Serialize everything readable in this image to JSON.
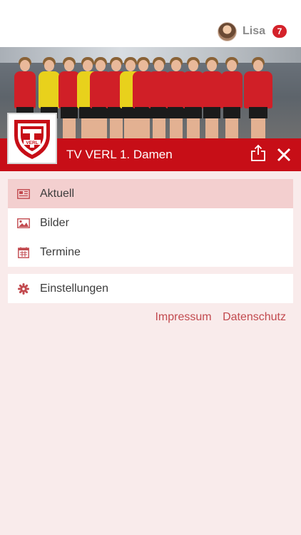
{
  "user": {
    "name": "Lisa",
    "notification_count": "7"
  },
  "team": {
    "title": "TV VERL 1. Damen",
    "logo_text": "VERL",
    "logo_year_left": "19",
    "logo_year_right": "12"
  },
  "menu": [
    {
      "label": "Aktuell",
      "icon": "newspaper-icon",
      "active": true
    },
    {
      "label": "Bilder",
      "icon": "image-icon",
      "active": false
    },
    {
      "label": "Termine",
      "icon": "calendar-icon",
      "active": false
    }
  ],
  "settings": {
    "label": "Einstellungen",
    "icon": "gear-icon"
  },
  "footer_links": {
    "impressum": "Impressum",
    "datenschutz": "Datenschutz"
  },
  "colors": {
    "brand_red": "#c70e17",
    "background": "#f9ebeb",
    "active_row": "#f3cfcf",
    "link": "#c24a4f",
    "badge": "#d4222a"
  }
}
